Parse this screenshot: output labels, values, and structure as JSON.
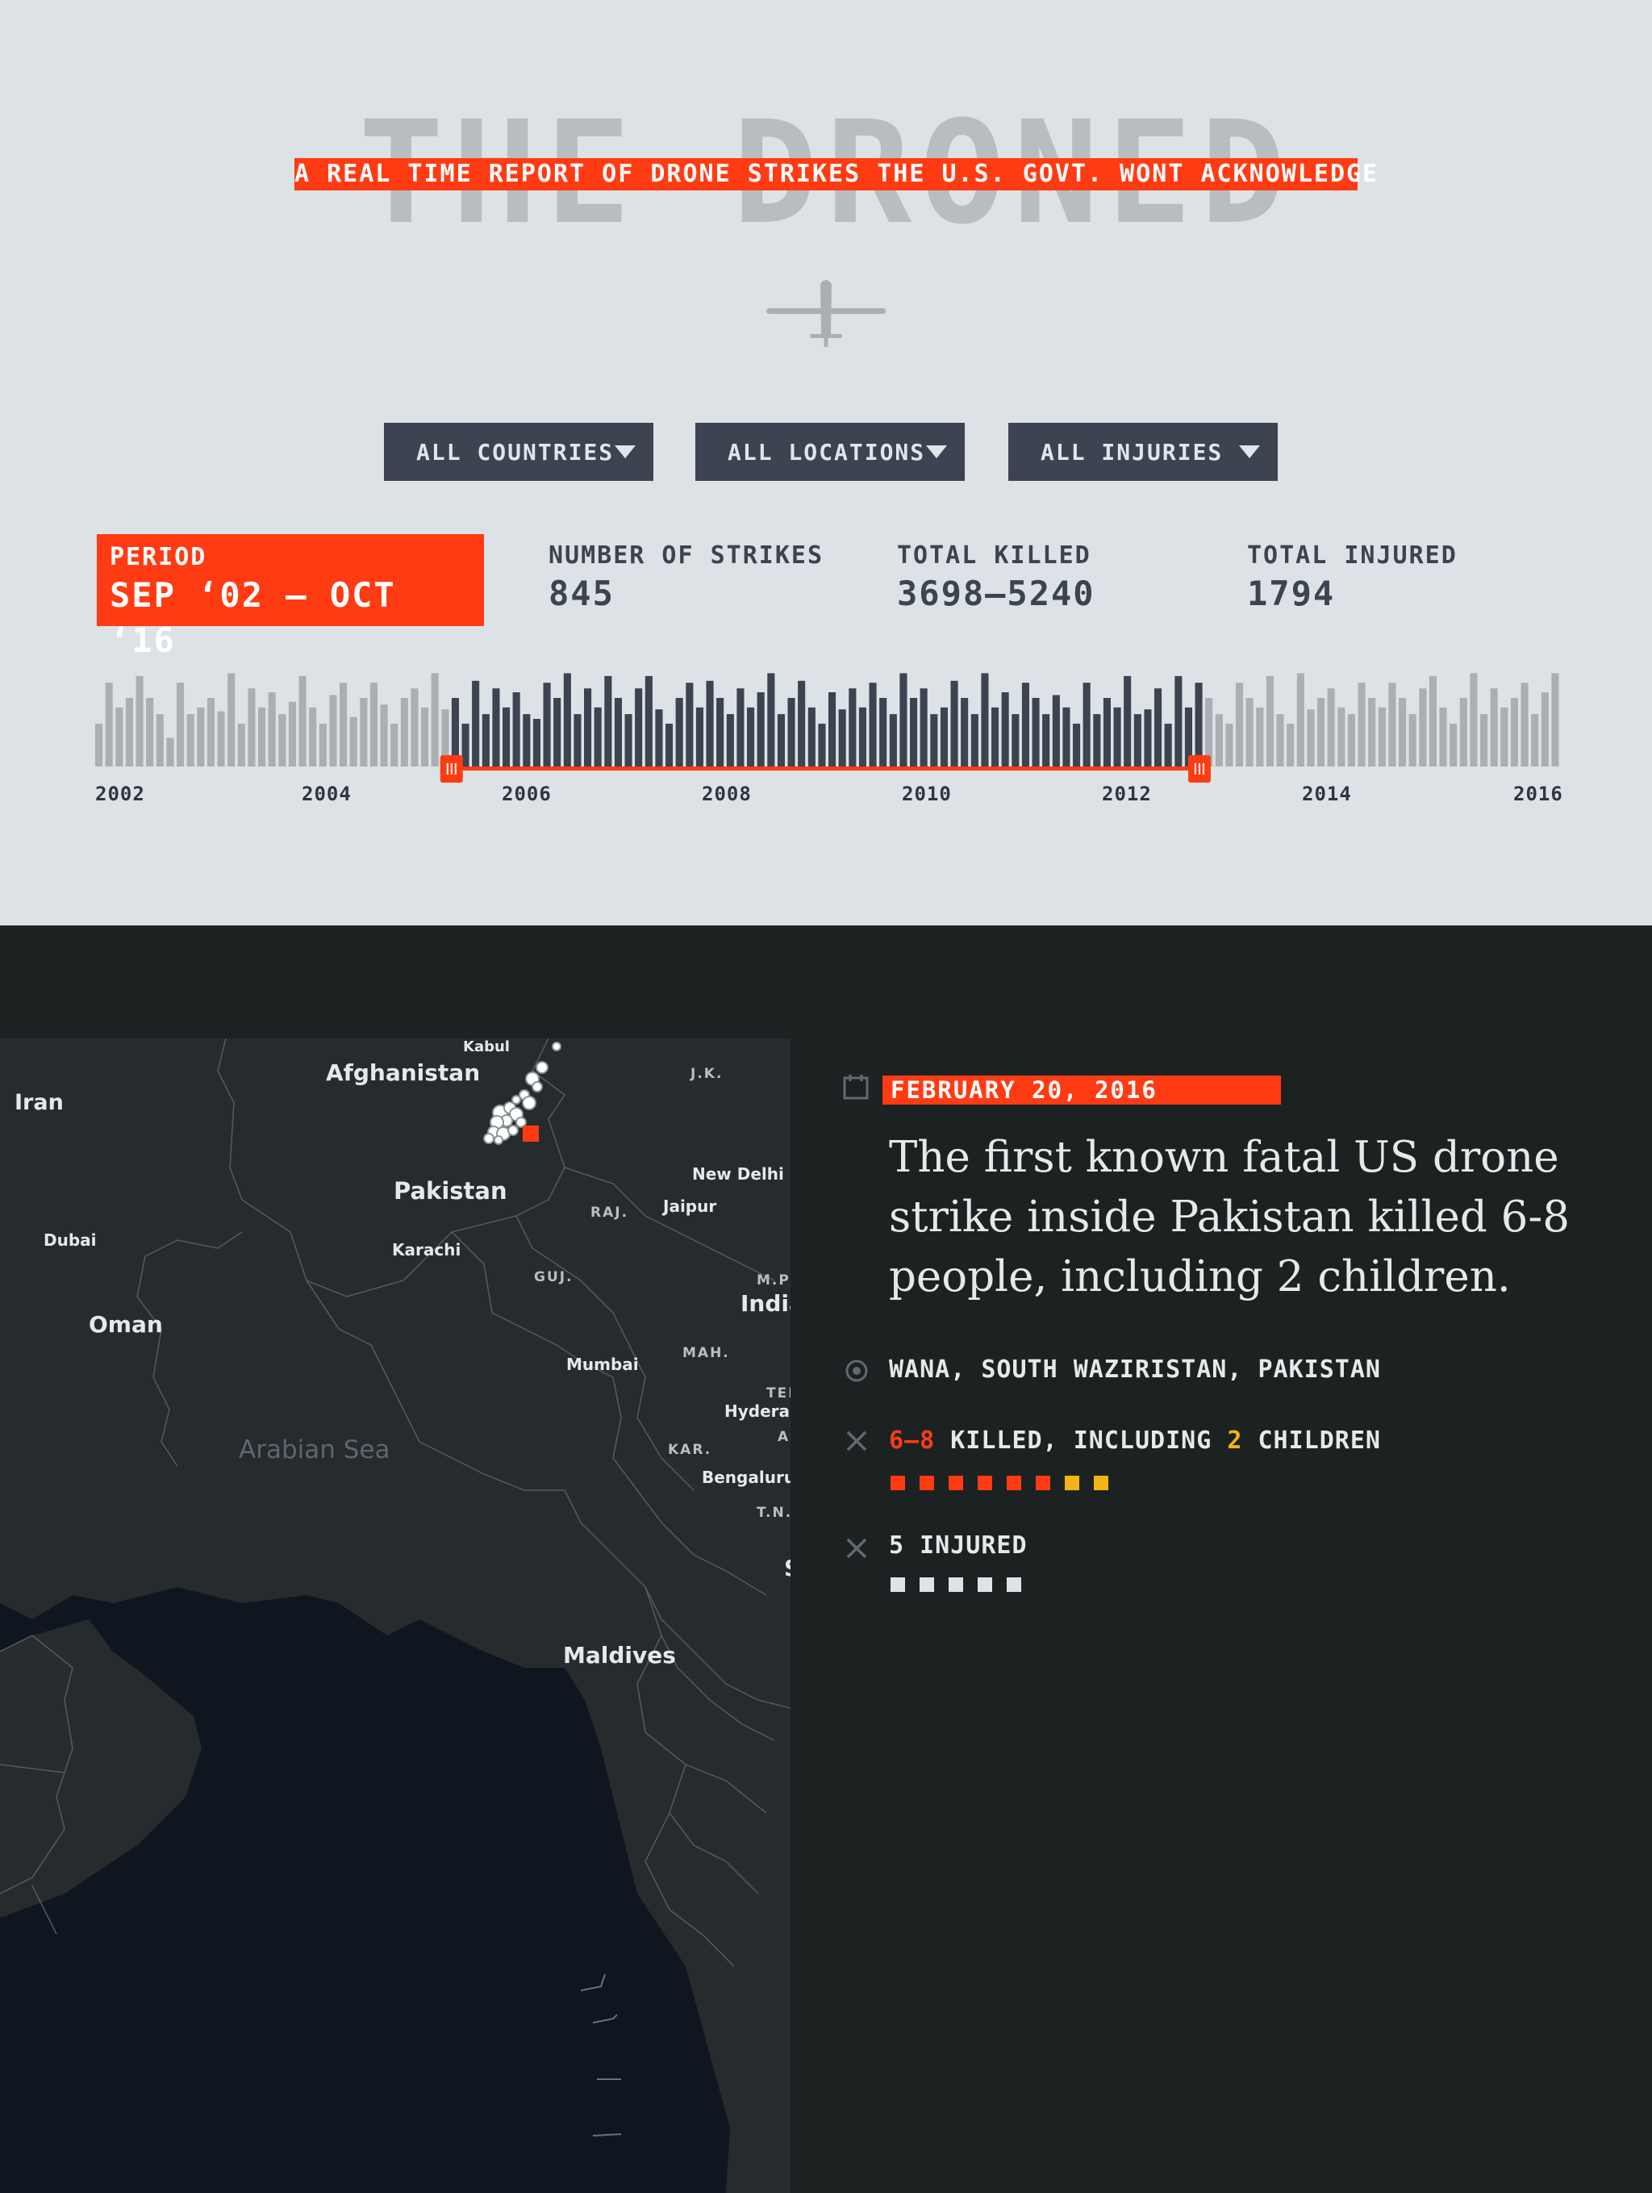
{
  "header": {
    "title": "THE DRONED",
    "subtitle": "A REAL TIME REPORT OF DRONE STRIKES THE U.S. GOVT. WONT ACKNOWLEDGE"
  },
  "filters": [
    {
      "label": "ALL COUNTRIES"
    },
    {
      "label": "ALL LOCATIONS"
    },
    {
      "label": "ALL INJURIES"
    }
  ],
  "stats": {
    "period_label": "PERIOD",
    "period_value": "SEP ‘02 — OCT ‘16",
    "strikes_label": "NUMBER OF STRIKES",
    "strikes_value": "845",
    "killed_label": "TOTAL KILLED",
    "killed_value": "3698–5240",
    "injured_label": "TOTAL INJURED",
    "injured_value": "1794"
  },
  "timeline": {
    "years": [
      "2002",
      "2004",
      "2006",
      "2008",
      "2010",
      "2012",
      "2014",
      "2016"
    ],
    "selected_range_fraction": [
      0.243,
      0.753
    ],
    "bar_levels": [
      0.45,
      0.88,
      0.62,
      0.72,
      0.95,
      0.72,
      0.55,
      0.3,
      0.88,
      0.55,
      0.62,
      0.72,
      0.58,
      0.98,
      0.45,
      0.82,
      0.62,
      0.78,
      0.55,
      0.68,
      0.95,
      0.62,
      0.45,
      0.75,
      0.88,
      0.52,
      0.72,
      0.88,
      0.65,
      0.45,
      0.72,
      0.82,
      0.62,
      0.98,
      0.6,
      0.72,
      0.45,
      0.9,
      0.55,
      0.82,
      0.62,
      0.78,
      0.55,
      0.5,
      0.88,
      0.72,
      0.98,
      0.55,
      0.82,
      0.62,
      0.95,
      0.72,
      0.55,
      0.82,
      0.95,
      0.6,
      0.45,
      0.72,
      0.88,
      0.62,
      0.9,
      0.72,
      0.55,
      0.82,
      0.62,
      0.78,
      0.98,
      0.55,
      0.72,
      0.9,
      0.62,
      0.45,
      0.78,
      0.6,
      0.82,
      0.62,
      0.88,
      0.72,
      0.55,
      0.98,
      0.72,
      0.82,
      0.55,
      0.62,
      0.9,
      0.72,
      0.55,
      0.98,
      0.62,
      0.78,
      0.55,
      0.88,
      0.72,
      0.55,
      0.75,
      0.62,
      0.45,
      0.88,
      0.55,
      0.72,
      0.62,
      0.95,
      0.55,
      0.6,
      0.82,
      0.45,
      0.95,
      0.62,
      0.88,
      0.72,
      0.55,
      0.45,
      0.88,
      0.72,
      0.62,
      0.95,
      0.55,
      0.45,
      0.98,
      0.6,
      0.72,
      0.82,
      0.62,
      0.55,
      0.88,
      0.72,
      0.62,
      0.88,
      0.72,
      0.55,
      0.82,
      0.95,
      0.62,
      0.45,
      0.72,
      0.98,
      0.55,
      0.82,
      0.62,
      0.72,
      0.88,
      0.55,
      0.78,
      0.98
    ],
    "colors": {
      "selected": "#3b4450",
      "unselected": "#a9afb2",
      "handle": "#ff3b14"
    }
  },
  "map": {
    "labels": [
      {
        "text": "Kabul",
        "kind": "city"
      },
      {
        "text": "Afghanistan",
        "kind": "country"
      },
      {
        "text": "J.K.",
        "kind": "region"
      },
      {
        "text": "Iran",
        "kind": "country"
      },
      {
        "text": "New Delhi",
        "kind": "city"
      },
      {
        "text": "Pakistan",
        "kind": "country"
      },
      {
        "text": "RAJ.",
        "kind": "region"
      },
      {
        "text": "Jaipur",
        "kind": "city"
      },
      {
        "text": "Dubai",
        "kind": "city"
      },
      {
        "text": "Karachi",
        "kind": "city"
      },
      {
        "text": "GUJ.",
        "kind": "region"
      },
      {
        "text": "M.P",
        "kind": "region"
      },
      {
        "text": "India",
        "kind": "country"
      },
      {
        "text": "Oman",
        "kind": "country"
      },
      {
        "text": "Mumbai",
        "kind": "city"
      },
      {
        "text": "MAH.",
        "kind": "region"
      },
      {
        "text": "TEI",
        "kind": "region"
      },
      {
        "text": "Hyderab",
        "kind": "city"
      },
      {
        "text": "A",
        "kind": "region"
      },
      {
        "text": "Arabian Sea",
        "kind": "sea"
      },
      {
        "text": "KAR.",
        "kind": "region"
      },
      {
        "text": "Bengaluru",
        "kind": "city"
      },
      {
        "text": "T.N.",
        "kind": "region"
      },
      {
        "text": "Maldives",
        "kind": "country"
      },
      {
        "text": "S",
        "kind": "country"
      }
    ]
  },
  "detail": {
    "date": "FEBRUARY 20, 2016",
    "story": "The first known fatal US drone strike inside Pakistan killed 6-8 people, including 2 children.",
    "location": "WANA, SOUTH WAZIRISTAN, PAKISTAN",
    "killed_range": "6–8",
    "killed_text": " KILLED, INCLUDING ",
    "children_count": "2",
    "children_text": " CHILDREN",
    "injured_text": "5 INJURED",
    "killed_squares": 8,
    "children_squares": 2,
    "injured_squares": 5,
    "colors": {
      "killed": "#ff3b14",
      "children": "#f5b413",
      "injured": "#dfe3e6"
    },
    "icons": [
      "calendar-icon",
      "location-target-icon",
      "close-x-icon",
      "close-x-icon"
    ]
  }
}
